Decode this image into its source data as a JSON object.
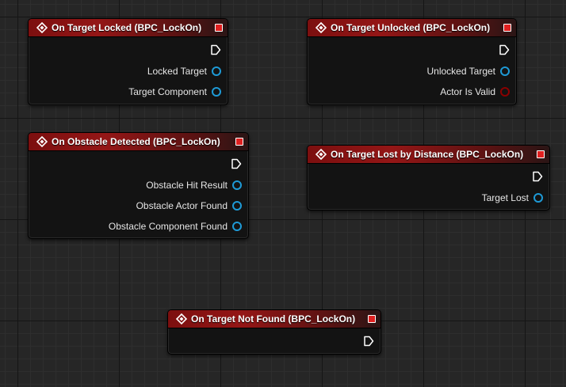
{
  "colors": {
    "header_red": "#941616",
    "object_pin": "#1e9ad6",
    "bool_pin": "#8b0000",
    "delegate_pin": "#e02020"
  },
  "nodes": {
    "target_locked": {
      "title": "On Target Locked (BPC_LockOn)",
      "pins": [
        {
          "label": "Locked Target",
          "type": "object"
        },
        {
          "label": "Target Component",
          "type": "object"
        }
      ]
    },
    "target_unlocked": {
      "title": "On Target Unlocked (BPC_LockOn)",
      "pins": [
        {
          "label": "Unlocked Target",
          "type": "object"
        },
        {
          "label": "Actor Is Valid",
          "type": "bool"
        }
      ]
    },
    "obstacle_detected": {
      "title": "On Obstacle Detected (BPC_LockOn)",
      "pins": [
        {
          "label": "Obstacle Hit Result",
          "type": "struct"
        },
        {
          "label": "Obstacle Actor Found",
          "type": "object"
        },
        {
          "label": "Obstacle Component Found",
          "type": "object"
        }
      ]
    },
    "target_lost": {
      "title": "On Target Lost by Distance (BPC_LockOn)",
      "pins": [
        {
          "label": "Target Lost",
          "type": "object"
        }
      ]
    },
    "target_not_found": {
      "title": "On Target Not Found (BPC_LockOn)",
      "pins": []
    }
  }
}
